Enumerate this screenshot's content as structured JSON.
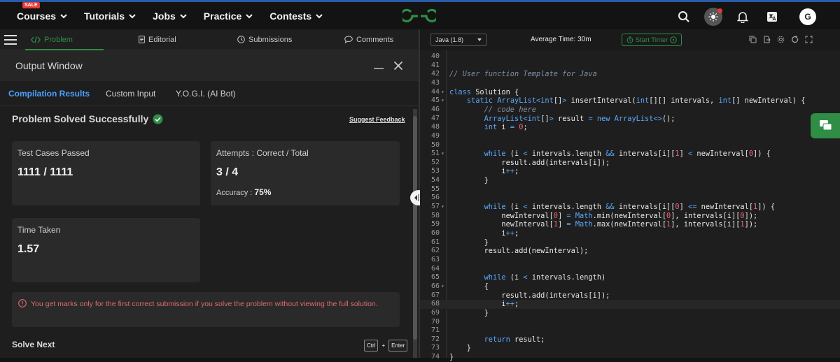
{
  "nav": {
    "sale": "SALE",
    "items": [
      "Courses",
      "Tutorials",
      "Jobs",
      "Practice",
      "Contests"
    ],
    "avatar_initial": "G"
  },
  "problem_tabs": [
    "Problem",
    "Editorial",
    "Submissions",
    "Comments"
  ],
  "output": {
    "title": "Output Window",
    "tabs": [
      "Compilation Results",
      "Custom Input",
      "Y.O.G.I. (AI Bot)"
    ],
    "status": "Problem Solved Successfully",
    "feedback_link": "Suggest Feedback",
    "test_cases_label": "Test Cases Passed",
    "test_cases_value": "1111 / 1111",
    "attempts_label": "Attempts : Correct / Total",
    "attempts_value": "3 / 4",
    "accuracy_label": "Accuracy :",
    "accuracy_value": "75%",
    "time_label": "Time Taken",
    "time_value": "1.57",
    "warning": "You get marks only for the first correct submission if you solve the problem without viewing the full solution.",
    "solve_next": "Solve Next"
  },
  "editor": {
    "language": "Java (1.8)",
    "avg_time": "Average Time: 30m",
    "timer_label": "Start Timer",
    "shortcut": [
      "Ctrl",
      "+",
      "Enter"
    ],
    "lines": [
      {
        "n": "40",
        "t": ""
      },
      {
        "n": "41",
        "t": ""
      },
      {
        "n": "42",
        "t": "// User function Template for Java"
      },
      {
        "n": "43",
        "t": ""
      },
      {
        "n": "44",
        "t": "class Solution {",
        "fold": true
      },
      {
        "n": "45",
        "t": "    static ArrayList<int[]> insertInterval(int[][] intervals, int[] newInterval) {",
        "fold": true
      },
      {
        "n": "46",
        "t": "        // code here"
      },
      {
        "n": "47",
        "t": "        ArrayList<int[]> result = new ArrayList<>();"
      },
      {
        "n": "48",
        "t": "        int i = 0;"
      },
      {
        "n": "49",
        "t": ""
      },
      {
        "n": "50",
        "t": ""
      },
      {
        "n": "51",
        "t": "        while (i < intervals.length && intervals[i][1] < newInterval[0]) {",
        "fold": true
      },
      {
        "n": "52",
        "t": "            result.add(intervals[i]);"
      },
      {
        "n": "53",
        "t": "            i++;"
      },
      {
        "n": "54",
        "t": "        }"
      },
      {
        "n": "55",
        "t": ""
      },
      {
        "n": "56",
        "t": ""
      },
      {
        "n": "57",
        "t": "        while (i < intervals.length && intervals[i][0] <= newInterval[1]) {",
        "fold": true
      },
      {
        "n": "58",
        "t": "            newInterval[0] = Math.min(newInterval[0], intervals[i][0]);"
      },
      {
        "n": "59",
        "t": "            newInterval[1] = Math.max(newInterval[1], intervals[i][1]);"
      },
      {
        "n": "60",
        "t": "            i++;"
      },
      {
        "n": "61",
        "t": "        }"
      },
      {
        "n": "62",
        "t": "        result.add(newInterval);"
      },
      {
        "n": "63",
        "t": ""
      },
      {
        "n": "64",
        "t": ""
      },
      {
        "n": "65",
        "t": "        while (i < intervals.length)"
      },
      {
        "n": "66",
        "t": "        {",
        "fold": true
      },
      {
        "n": "67",
        "t": "            result.add(intervals[i]);"
      },
      {
        "n": "68",
        "t": "            i++;",
        "current": true
      },
      {
        "n": "69",
        "t": "        }"
      },
      {
        "n": "70",
        "t": ""
      },
      {
        "n": "71",
        "t": ""
      },
      {
        "n": "72",
        "t": "        return result;"
      },
      {
        "n": "73",
        "t": "    }"
      },
      {
        "n": "74",
        "t": "}"
      }
    ]
  },
  "colors": {
    "brand_green": "#2f8d46",
    "link_blue": "#4aa1ff",
    "warning_red": "#e06a6a",
    "keyword": "#5aa9ff",
    "comment": "#7f8fa6",
    "number": "#f0627a",
    "type": "#5aa9ff"
  }
}
